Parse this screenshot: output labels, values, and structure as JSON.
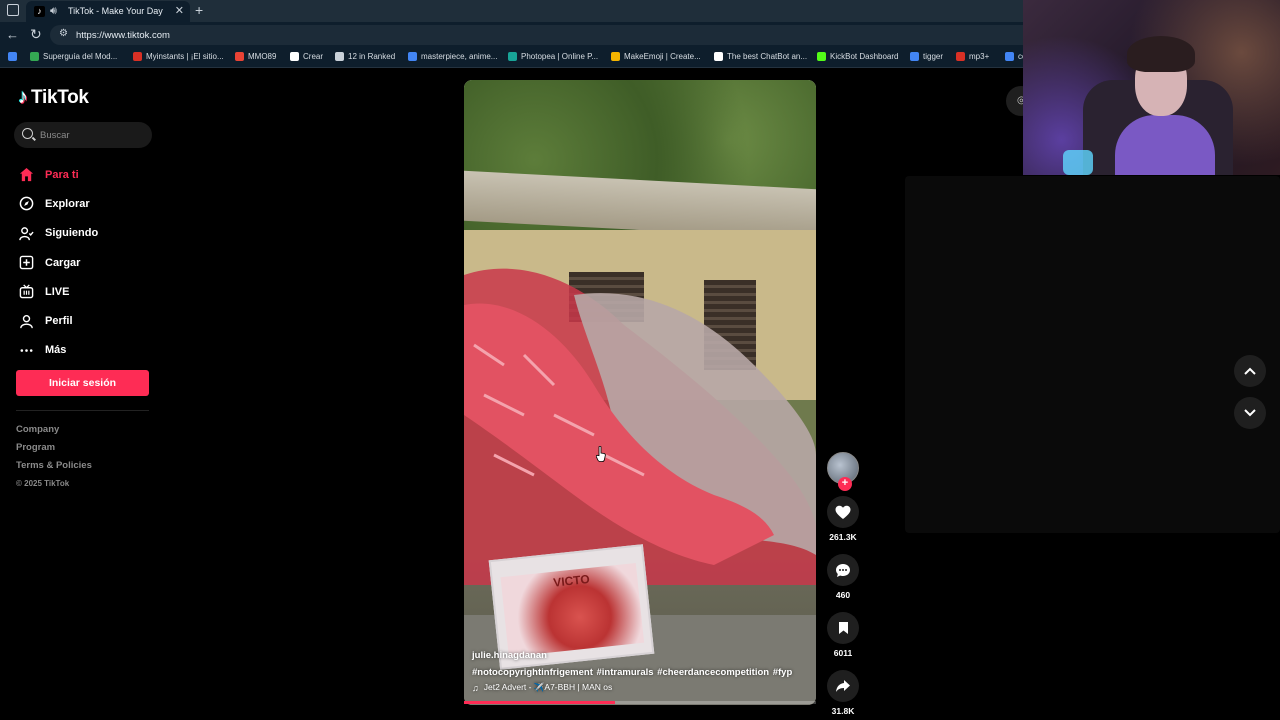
{
  "browser": {
    "tab_title": "TikTok - Make Your Day",
    "url": "https://www.tiktok.com",
    "bookmarks": [
      {
        "label": "Superguía del Mod...",
        "color": "#34a853"
      },
      {
        "label": "Myinstants | ¡El sitio...",
        "color": "#d93025"
      },
      {
        "label": "MMO89",
        "color": "#ea4335"
      },
      {
        "label": "Crear",
        "color": "#ffffff"
      },
      {
        "label": "12 in Ranked",
        "color": "#c9d1d9"
      },
      {
        "label": "masterpiece, anime...",
        "color": "#4285f4"
      },
      {
        "label": "Photopea | Online P...",
        "color": "#18a497"
      },
      {
        "label": "MakeEmoji | Create...",
        "color": "#f4b400"
      },
      {
        "label": "The best ChatBot an...",
        "color": "#ffffff"
      },
      {
        "label": "KickBot Dashboard",
        "color": "#53fc18"
      },
      {
        "label": "tigger",
        "color": "#4285f4"
      },
      {
        "label": "mp3+",
        "color": "#d93025"
      },
      {
        "label": "co",
        "color": "#4285f4"
      }
    ]
  },
  "tiktok": {
    "logo": "TikTok",
    "search_placeholder": "Buscar",
    "nav": [
      {
        "label": "Para ti",
        "icon": "home-icon"
      },
      {
        "label": "Explorar",
        "icon": "compass-icon"
      },
      {
        "label": "Siguiendo",
        "icon": "following-icon"
      },
      {
        "label": "Cargar",
        "icon": "upload-icon"
      },
      {
        "label": "LIVE",
        "icon": "live-icon"
      },
      {
        "label": "Perfil",
        "icon": "profile-icon"
      },
      {
        "label": "Más",
        "icon": "more-icon"
      }
    ],
    "login_button": "Iniciar sesión",
    "footer": {
      "links": [
        "Company",
        "Program",
        "Terms & Policies"
      ],
      "copyright": "© 2025 TikTok"
    },
    "accent_color": "#fe2c55"
  },
  "video": {
    "sign_text": "VICTO",
    "username": "julie.hinagdanan",
    "hashtags": "#notocopyrightinfrigement #intramurals #cheerdancecompetition #fyp",
    "music": "Jet2 Advert - ✈️A7-BBH | MAN os",
    "progress": 0.43,
    "likes": "261.3K",
    "comments": "460",
    "saves": "6011",
    "shares": "31.8K"
  }
}
